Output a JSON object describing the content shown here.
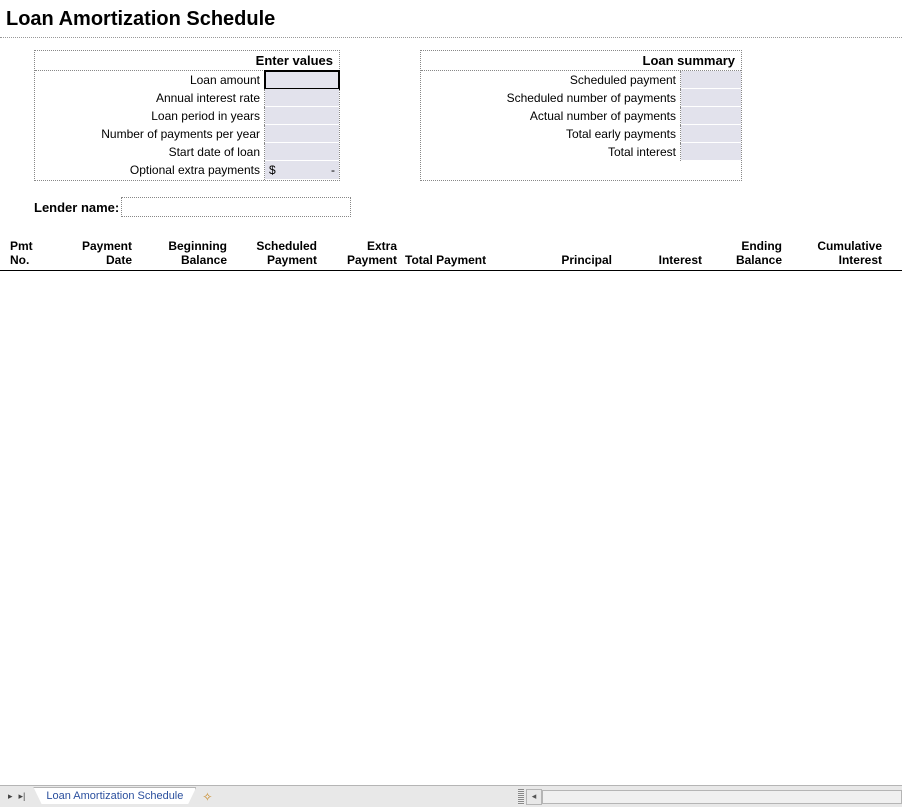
{
  "title": "Loan Amortization Schedule",
  "enter_values": {
    "header": "Enter values",
    "rows": [
      {
        "label": "Loan amount",
        "value": ""
      },
      {
        "label": "Annual interest rate",
        "value": ""
      },
      {
        "label": "Loan period in years",
        "value": ""
      },
      {
        "label": "Number of payments per year",
        "value": ""
      },
      {
        "label": "Start date of loan",
        "value": ""
      },
      {
        "label": "Optional extra payments",
        "value_prefix": "$",
        "value_suffix": "-"
      }
    ]
  },
  "loan_summary": {
    "header": "Loan summary",
    "rows": [
      {
        "label": "Scheduled payment",
        "value": ""
      },
      {
        "label": "Scheduled number of payments",
        "value": ""
      },
      {
        "label": "Actual number of payments",
        "value": ""
      },
      {
        "label": "Total early payments",
        "value": ""
      },
      {
        "label": "Total interest",
        "value": ""
      }
    ]
  },
  "lender": {
    "label": "Lender name:",
    "value": ""
  },
  "schedule_columns": {
    "pmt": "Pmt No.",
    "date": "Payment Date",
    "begin": "Beginning Balance",
    "sched": "Scheduled Payment",
    "extra": "Extra Payment",
    "total": "Total Payment",
    "princ": "Principal",
    "int": "Interest",
    "end": "Ending Balance",
    "cum": "Cumulative Interest"
  },
  "tabs": {
    "active": "Loan Amortization Schedule"
  }
}
